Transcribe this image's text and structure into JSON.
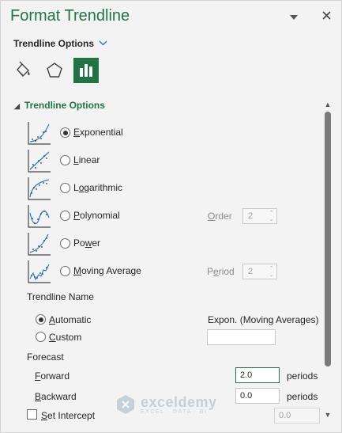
{
  "pane": {
    "title": "Format Trendline",
    "options_menu_label": "Trendline Options"
  },
  "tabs": [
    {
      "name": "fill-line",
      "icon": "paint-bucket-icon"
    },
    {
      "name": "effects",
      "icon": "pentagon-icon"
    },
    {
      "name": "trendline-options",
      "icon": "bar-chart-icon",
      "active": true
    }
  ],
  "section": {
    "title": "Trendline Options"
  },
  "types": [
    {
      "label": "Exponential",
      "mnemonic": "E",
      "rest": "xponential",
      "selected": true
    },
    {
      "label": "Linear",
      "mnemonic": "L",
      "rest": "inear",
      "selected": false
    },
    {
      "label": "Logarithmic",
      "mnemonic": "o",
      "pre": "L",
      "rest": "garithmic",
      "selected": false
    },
    {
      "label": "Polynomial",
      "mnemonic": "P",
      "rest": "olynomial",
      "selected": false
    },
    {
      "label": "Power",
      "mnemonic": "w",
      "pre": "Po",
      "rest": "er",
      "selected": false
    },
    {
      "label": "Moving Average",
      "mnemonic": "M",
      "rest": "oving Average",
      "selected": false
    }
  ],
  "polynomial_order": {
    "label_pre": "",
    "label_ul": "O",
    "label_rest": "rder",
    "value": "2"
  },
  "moving_period": {
    "label_pre": "P",
    "label_ul": "e",
    "label_rest": "riod",
    "value": "2"
  },
  "trendline_name": {
    "heading": "Trendline Name",
    "automatic_ul": "A",
    "automatic_rest": "utomatic",
    "automatic_value": "Expon. (Moving Averages)",
    "custom_ul": "C",
    "custom_rest": "ustom",
    "custom_value": ""
  },
  "forecast": {
    "heading": "Forecast",
    "forward_ul": "F",
    "forward_rest": "orward",
    "forward_value": "2.0",
    "backward_ul": "B",
    "backward_rest": "ackward",
    "backward_value": "0.0",
    "unit": "periods"
  },
  "intercept": {
    "ul": "S",
    "rest": "et Intercept",
    "value": "0.0"
  },
  "watermark": {
    "brand": "exceldemy",
    "tagline": "EXCEL · DATA · BI"
  },
  "colors": {
    "accent": "#217346",
    "chart_blue": "#2b7cd3"
  }
}
